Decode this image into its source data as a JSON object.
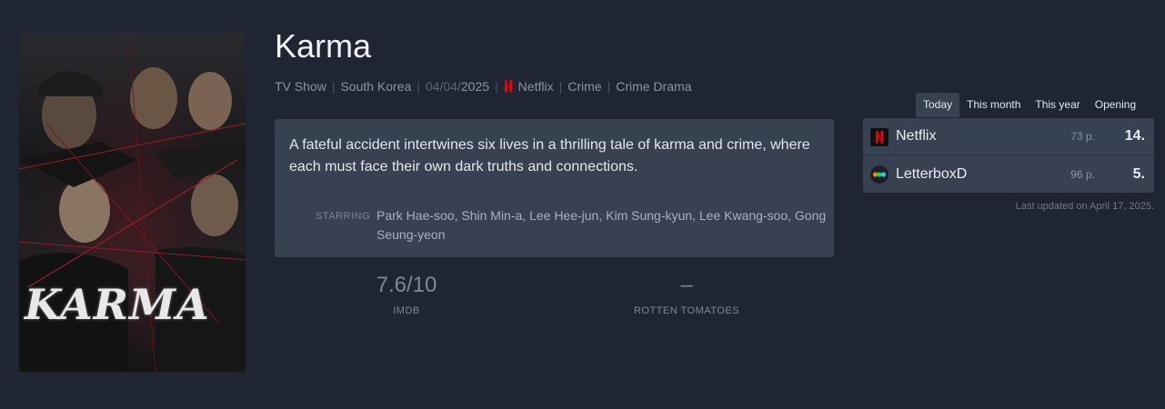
{
  "poster": {
    "title_art": "KARMA"
  },
  "title": "Karma",
  "meta": {
    "type": "TV Show",
    "country": "South Korea",
    "date_prefix": "04/04/",
    "date_year": "2025",
    "network": "Netflix",
    "genre1": "Crime",
    "genre2": "Crime Drama"
  },
  "description": "A fateful accident intertwines six lives in a thrilling tale of karma and crime, where each must face their own dark truths and connections.",
  "starring": {
    "label": "STARRING",
    "names": "Park Hae-soo, Shin Min-a, Lee Hee-jun, Kim Sung-kyun, Lee Kwang-soo, Gong Seung-yeon"
  },
  "ratings": {
    "imdb": {
      "value": "7.6/10",
      "label": "IMDB"
    },
    "rotten": {
      "value": "–",
      "label": "ROTTEN TOMATOES"
    }
  },
  "ranking": {
    "tabs": [
      "Today",
      "This month",
      "This year",
      "Opening"
    ],
    "active_tab": "Today",
    "rows": [
      {
        "name": "Netflix",
        "points": "73 p.",
        "position": "14.",
        "icon": "netflix-icon"
      },
      {
        "name": "LetterboxD",
        "points": "96 p.",
        "position": "5.",
        "icon": "letterboxd-icon"
      }
    ],
    "updated": "Last updated on April 17, 2025."
  },
  "colors": {
    "background": "#1f2533",
    "card": "#384152",
    "netflix_red": "#e50914"
  }
}
